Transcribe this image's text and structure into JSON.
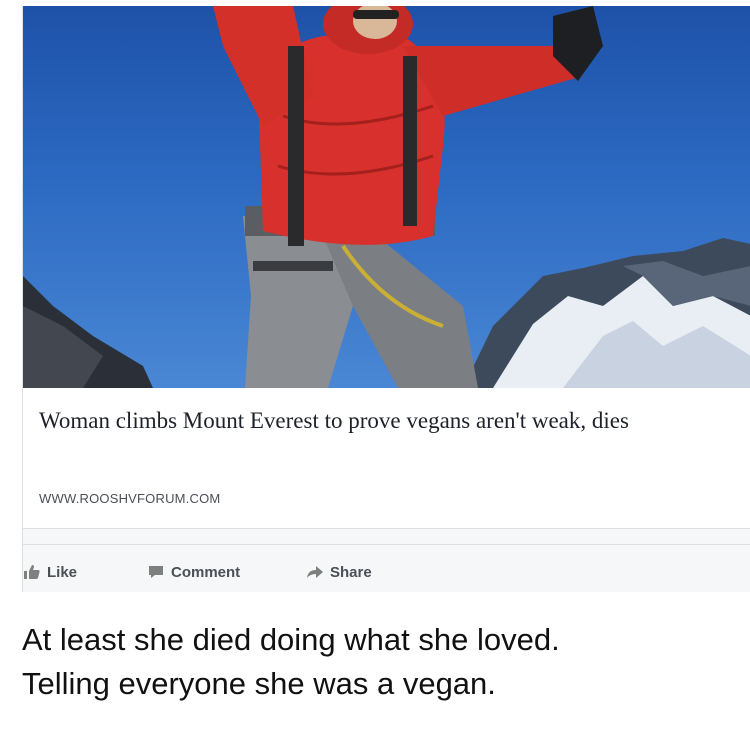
{
  "post": {
    "headline": "Woman climbs Mount Everest to prove vegans aren't weak, dies",
    "domain": "WWW.ROOSHVFORUM.COM",
    "image_alt": "Climber in red jacket on summit with snowy peak"
  },
  "actions": {
    "like": "Like",
    "comment": "Comment",
    "share": "Share"
  },
  "caption": {
    "line1": "At least she died doing what she loved.",
    "line2": "Telling everyone she was a vegan."
  },
  "colors": {
    "sky": "#2c69c2",
    "jacket": "#d8302c",
    "text": "#1d2129",
    "muted": "#4b4f56"
  }
}
